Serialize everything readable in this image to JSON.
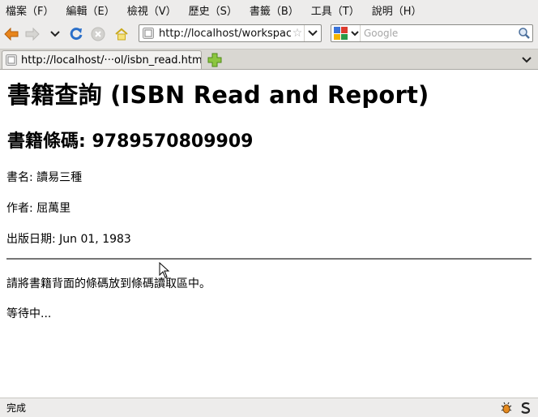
{
  "menubar": {
    "items": [
      "檔案（F）",
      "編輯（E）",
      "檢視（V）",
      "歷史（S）",
      "書籤（B）",
      "工具（T）",
      "說明（H）"
    ]
  },
  "navbar": {
    "url": "http://localhost/workspace",
    "search_placeholder": "Google",
    "icons": [
      "back-arrow-icon",
      "forward-arrow-icon",
      "history-dropdown-icon",
      "reload-icon",
      "stop-icon",
      "home-icon"
    ]
  },
  "tabs": [
    {
      "title": "http://localhost/···ol/isbn_read.html",
      "active": true
    }
  ],
  "page": {
    "title": "書籍查詢 (ISBN Read and Report)",
    "barcode_heading": "書籍條碼: 9789570809909",
    "book_name": "書名: 讀易三種",
    "author": "作者: 屈萬里",
    "publish_date": "出版日期: Jun 01, 1983",
    "instruction": "請將書籍背面的條碼放到條碼讀取區中。",
    "waiting": "等待中..."
  },
  "statusbar": {
    "text": "完成"
  },
  "colors": {
    "chrome_bg": "#edeceb",
    "back_arrow": "#e8851c",
    "reload": "#2a6fc9",
    "add_tab": "#6aae2c"
  }
}
